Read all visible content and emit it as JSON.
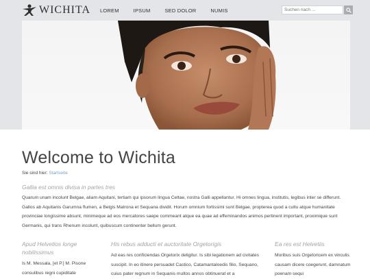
{
  "header": {
    "logo_text": "WICHITA",
    "nav": [
      "LOREM",
      "IPSUM",
      "SED DOLOR",
      "NUMIS"
    ],
    "search_placeholder": "Suchen nach ..."
  },
  "main": {
    "title": "Welcome to Wichita",
    "breadcrumb_label": "Sie sind hier:",
    "breadcrumb_link": "Startseite",
    "subhead": "Gallia est omnis divisa in partes tres",
    "paragraph": "Quarum unam incolunt Belgae, aliam Aquitani, tertiam qui ipsorum lingua Celtae, nostra Galli appellantur. Hi omnes lingua, institutis, legibus inter se differunt. Gallos ab Aquitanis Garumna flumen, a Belgis Matrona et Sequana dividit. Horum omnium fortissimi sunt Belgae, propterea quod a cultu atque humanitate provinciae longissime absunt, minimeque ad eos mercatores saepe commeant atque ea quae ad effeminandos animos pertinent important, proximique sunt Germanis, qui trans Rhenum incolunt, quibuscum continenter bellum gerunt."
  },
  "columns": [
    {
      "title": "Apud Helvetios longe nobilissimus",
      "text": "Is M. Messala, [et P.] M. Pisone consulibus regni cupiditate"
    },
    {
      "title": "His rebus adducti et auctoritate Orgetorigis",
      "text": "Ad eas res conficiendas Orgetorix deligitur. Is sibi legationem ad civitates suscipit. In eo itinere persuadet Castico, Catamantaloedis filio, Sequano, cuius pater regnum in Sequanis multos annos obtinuerat et a"
    },
    {
      "title": "Ea res est Helvetiis",
      "text": "Moribus suis Orgetoricem ex vinculis causam dicere coegerunt, damnatum poenam sequi"
    }
  ]
}
